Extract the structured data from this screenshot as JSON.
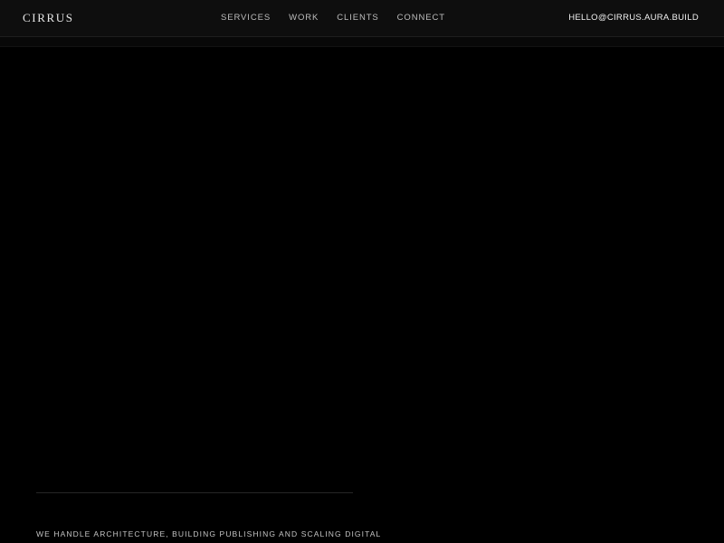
{
  "header": {
    "logo": "CIRRUS",
    "nav": [
      {
        "label": "SERVICES"
      },
      {
        "label": "WORK"
      },
      {
        "label": "CLIENTS"
      },
      {
        "label": "CONNECT"
      }
    ],
    "email": "HELLO@CIRRUS.AURA.BUILD"
  },
  "hero": {
    "tagline": "WE HANDLE ARCHITECTURE, BUILDING PUBLISHING AND SCALING DIGITAL"
  },
  "colors": {
    "background": "#000000",
    "header_background": "#0e0e0e",
    "text": "#cfcfcf"
  }
}
